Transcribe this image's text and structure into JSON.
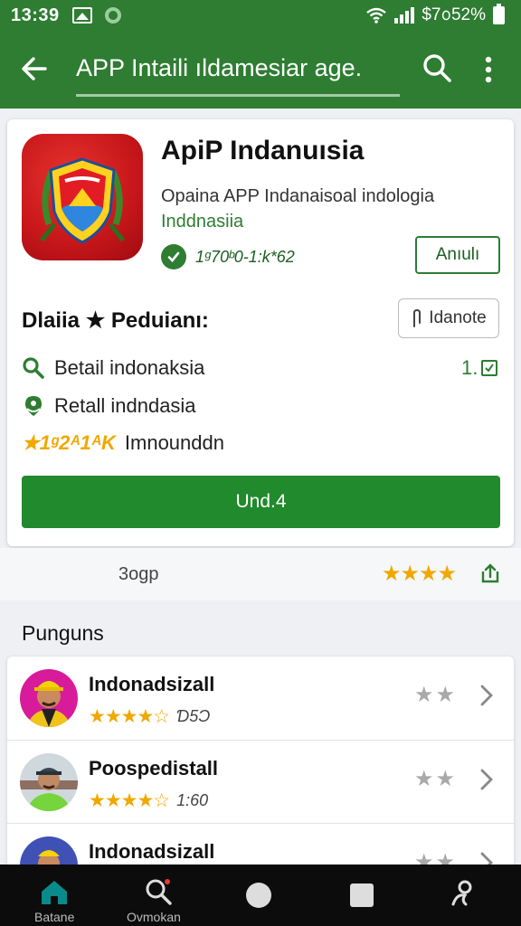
{
  "status_bar": {
    "time": "13:39",
    "right_text": "$7᪀52%",
    "icons": [
      "gallery-icon",
      "settings-icon",
      "wifi-icon",
      "signal-icon",
      "battery-icon"
    ]
  },
  "app_bar": {
    "title": "APP Intaili ıldamesiar age.",
    "icons": [
      "back-arrow-icon",
      "search-icon",
      "more-vert-icon"
    ]
  },
  "app": {
    "name": "ApiP Indanuısia",
    "description": "Opaina APP Indanaisoal indologia",
    "developer": "Inddnasiia",
    "rating_text": "1ᵍ70ᵇ0-1:k*62",
    "action_button": "Anıulı"
  },
  "details": {
    "title": "Dlaiia ★ Peduianı:",
    "note_button": "Idanote",
    "row1_label": "Betail indonaksia",
    "row1_value": "1.",
    "row2_label": "Retall indndasia",
    "row3_stars": "★1ᵍ2ᴬ1ᴬK",
    "row3_label": "Imnounddn",
    "primary_button": "Und.4"
  },
  "meta": {
    "size": "3ogp",
    "stars": "★★★★",
    "rating": 4
  },
  "list": {
    "heading": "Punguns",
    "items": [
      {
        "name": "Indonadsizall",
        "stars": "★★★★☆",
        "count": "Ɗ5Ɔ",
        "right_stars": "★★"
      },
      {
        "name": "Poospedistall",
        "stars": "★★★★☆",
        "count": "1:60",
        "right_stars": "★★"
      },
      {
        "name": "Indonadsizall",
        "stars": "★★★★☆",
        "count": "",
        "right_stars": "★★"
      }
    ]
  },
  "bottom_nav": {
    "items": [
      {
        "label": "Batane",
        "icon": "home-icon"
      },
      {
        "label": "Ovmokan",
        "icon": "search-icon"
      },
      {
        "label": "",
        "icon": "circle-icon"
      },
      {
        "label": "",
        "icon": "square-icon"
      },
      {
        "label": "",
        "icon": "profile-icon"
      }
    ]
  },
  "colors": {
    "primary": "#2e7d32",
    "button_green": "#218a2c",
    "star": "#f0a800",
    "app_icon_red": "#c6161a"
  }
}
